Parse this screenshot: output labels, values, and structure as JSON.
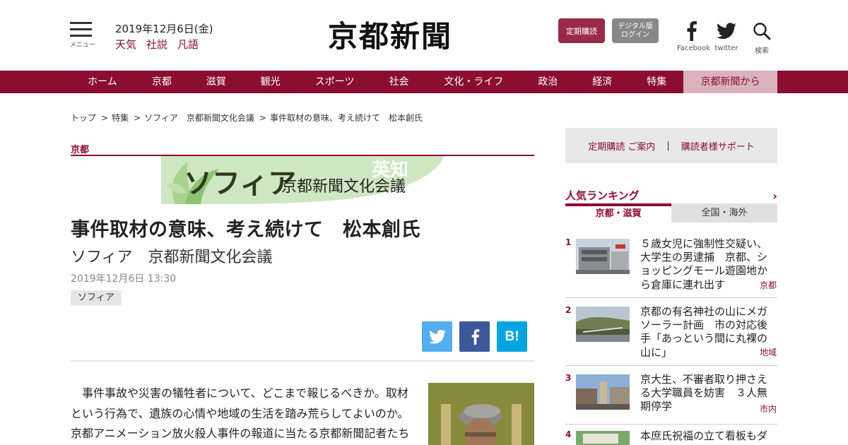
{
  "header": {
    "menu_label": "メニュー",
    "date": "2019年12月6日(金)",
    "links": [
      "天気",
      "社説",
      "凡語"
    ],
    "logo": "京都新聞",
    "subscribe_btn": "定期購読",
    "digital_btn_line1": "デジタル版",
    "digital_btn_line2": "ログイン",
    "facebook_label": "Facebook",
    "twitter_label": "twitter",
    "search_label": "検索"
  },
  "nav": {
    "items": [
      "ホーム",
      "京都",
      "滋賀",
      "観光",
      "スポーツ",
      "社会",
      "文化・ライフ",
      "政治",
      "経済",
      "特集",
      "京都新聞から"
    ]
  },
  "breadcrumb": {
    "items": [
      "トップ",
      "特集",
      "ソフィア　京都新聞文化会議",
      "事件取材の意味、考え続けて　松本創氏"
    ]
  },
  "article": {
    "category": "京都",
    "banner_title": "ソフィア",
    "banner_sub": "京都新聞文化会議",
    "banner_mark": "英知",
    "headline": "事件取材の意味、考え続けて　松本創氏",
    "subhead": "ソフィア　京都新聞文化会議",
    "published": "2019年12月6日 13:30",
    "tag": "ソフィア",
    "share_hatena": "B!",
    "body_lines": [
      "事件事故や災害の犠牲者について、どこまで報じるべきか。取材",
      "という行為で、遺族の心情や地域の生活を踏み荒らしてよいのか。",
      "京都アニメーション放火殺人事件の報道に当たる京都新聞記者たち"
    ]
  },
  "sidebar": {
    "support_left": "定期購読 ご案内",
    "support_sep": "|",
    "support_right": "購読者様サポート",
    "ranking_title": "人気ランキング",
    "ranking_chevron": "›",
    "tab_local": "京都・滋賀",
    "tab_national": "全国・海外",
    "ranking": [
      {
        "rank": "1",
        "title": "５歳女児に強制性交疑い、大学生の男逮捕　京都、ショッピングモール遊園地から倉庫に連れ出す",
        "region": "京都"
      },
      {
        "rank": "2",
        "title": "京都の有名神社の山にメガソーラー計画　市の対応後手「あっという間に丸裸の山に」",
        "region": "地域"
      },
      {
        "rank": "3",
        "title": "京大生、不審者取り押さえる大学職員を妨害　３人無期停学",
        "region": "市内"
      },
      {
        "rank": "4",
        "title": "本庶氏祝福の立て看板もダ",
        "region": ""
      }
    ]
  },
  "colors": {
    "brand": "#8b0d32",
    "twitter": "#55acee",
    "facebook": "#3b5998",
    "hatena": "#00a4de"
  }
}
